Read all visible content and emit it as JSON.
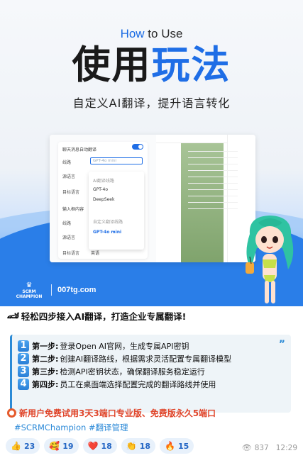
{
  "poster": {
    "howto_highlight": "How",
    "howto_rest": " to Use",
    "title_a": "使用",
    "title_b": "玩法",
    "subtitle": "自定义AI翻译，提升语言转化",
    "brand_top": "SCRM",
    "brand_bottom": "CHAMPION",
    "site": "007tg.com",
    "settings": {
      "auto_translate": "聊天消息自动翻译",
      "route_label": "线路",
      "route_value": "GPT-4o mini",
      "source_label": "源语言",
      "target_label": "目标语言",
      "input_label": "输入框内容",
      "route2_label": "线路",
      "source2_label": "源语言",
      "target2_label": "目标语言",
      "target2_value": "英语"
    },
    "dropdown": {
      "group": "AI翻译线路",
      "opt1": "GPT-4o",
      "opt2": "DeepSeek",
      "group2": "自定义翻译线路",
      "opt3": "GPT-4o mini"
    }
  },
  "message": {
    "headline_emoji": "🏎",
    "headline": "轻松四步接入AI翻译，打造企业专属翻译!",
    "steps": [
      {
        "num": "1",
        "key": "第一步:",
        "text": "登录Open AI官网，生成专属API密钥"
      },
      {
        "num": "2",
        "key": "第二步:",
        "text": "创建AI翻译路线，根据需求灵活配置专属翻译模型"
      },
      {
        "num": "3",
        "key": "第三步:",
        "text": "检测API密钥状态，确保翻译服务稳定运行"
      },
      {
        "num": "4",
        "key": "第四步:",
        "text": "员工在桌面端选择配置完成的翻译路线并使用"
      }
    ],
    "quote_mark": "”",
    "promo": "新用户免费试用3天3端口专业版、免费版永久5端口",
    "tags": "#SCRMChampion #翻译管理"
  },
  "reactions": [
    {
      "icon": "👍",
      "count": "23"
    },
    {
      "icon": "🥰",
      "count": "19"
    },
    {
      "icon": "❤️",
      "count": "18"
    },
    {
      "icon": "👏",
      "count": "18"
    },
    {
      "icon": "🔥",
      "count": "15"
    }
  ],
  "meta": {
    "views": "837",
    "time": "12:29"
  },
  "colors": {
    "accent": "#1f6ee6",
    "link": "#2c8ad8",
    "promo": "#e0452a"
  }
}
